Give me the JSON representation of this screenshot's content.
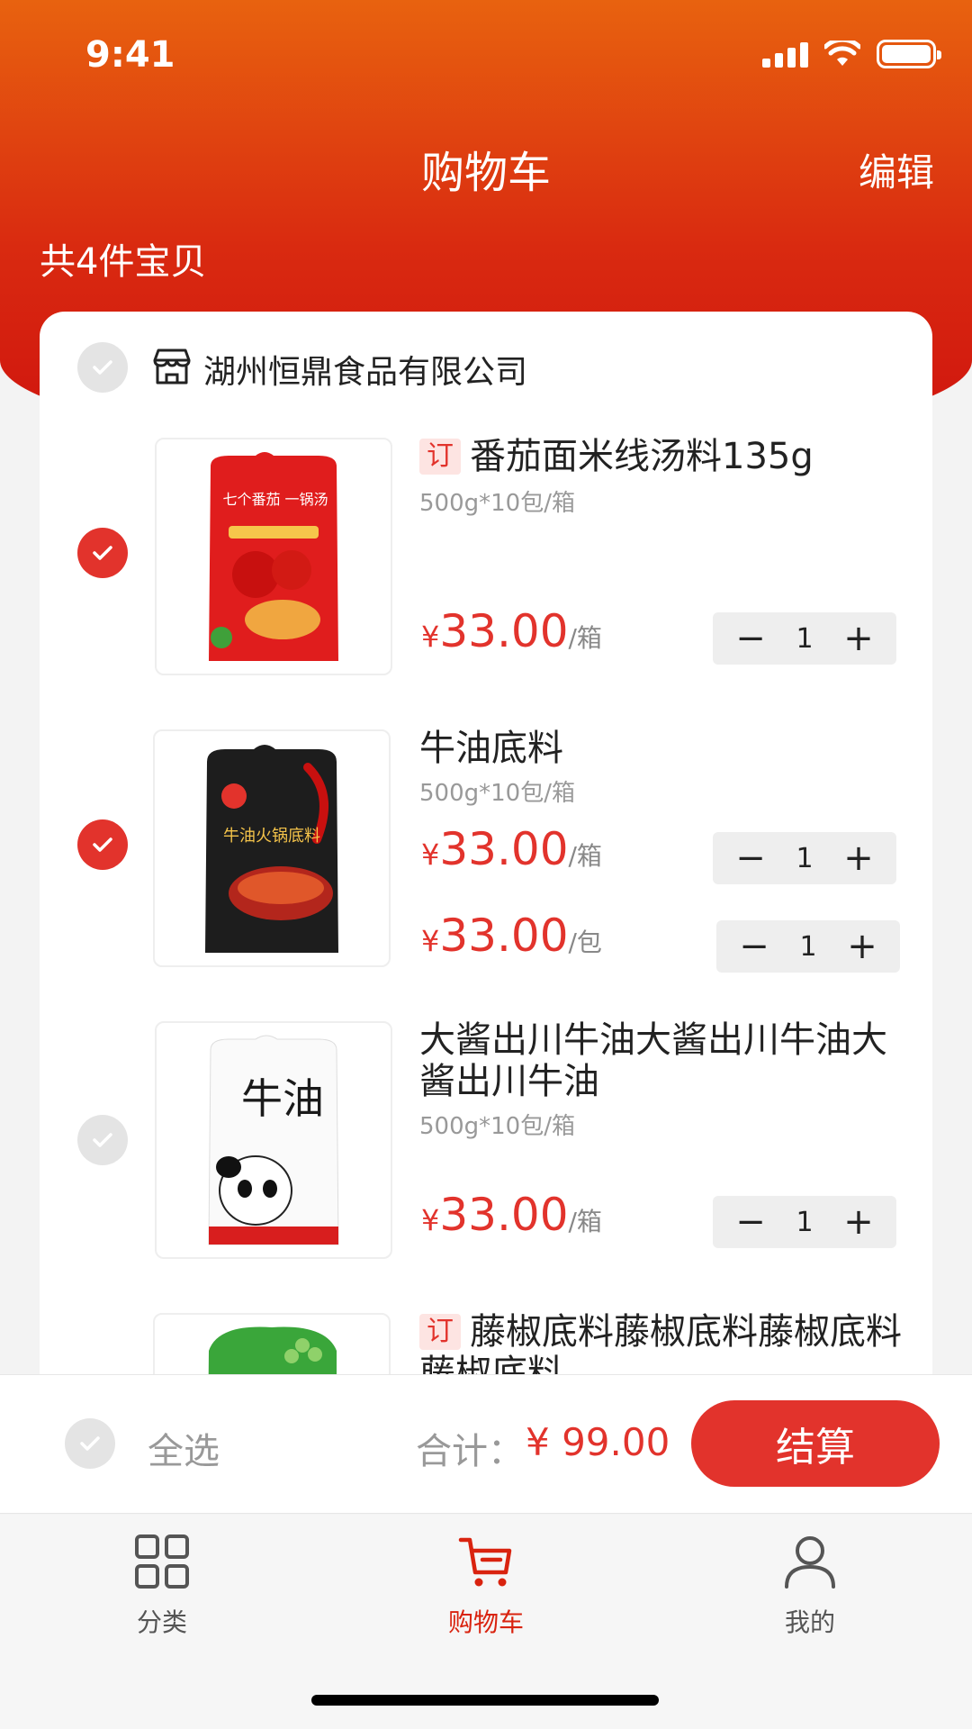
{
  "status_bar": {
    "time": "9:41"
  },
  "nav": {
    "title": "购物车",
    "edit_label": "编辑"
  },
  "cart": {
    "count_label": "共4件宝贝"
  },
  "shop": {
    "name": "湖州恒鼎食品有限公司",
    "selected": false
  },
  "items": [
    {
      "tag": "订",
      "title": "番茄面米线汤料135g",
      "spec": "500g*10包/箱",
      "selected": true,
      "image_label": "七个番茄 一锅汤",
      "prices": [
        {
          "currency": "¥",
          "value": "33.00",
          "unit": "/箱",
          "qty": "1"
        }
      ]
    },
    {
      "tag": "",
      "title": "牛油底料",
      "spec": "500g*10包/箱",
      "selected": true,
      "image_label": "牛油火锅底料",
      "prices": [
        {
          "currency": "¥",
          "value": "33.00",
          "unit": "/箱",
          "qty": "1"
        },
        {
          "currency": "¥",
          "value": "33.00",
          "unit": "/包",
          "qty": "1"
        }
      ]
    },
    {
      "tag": "",
      "title": "大酱出川牛油大酱出川牛油大酱出川牛油",
      "spec": "500g*10包/箱",
      "selected": false,
      "image_label": "牛油",
      "prices": [
        {
          "currency": "¥",
          "value": "33.00",
          "unit": "/箱",
          "qty": "1"
        }
      ]
    },
    {
      "tag": "订",
      "title": "藤椒底料藤椒底料藤椒底料藤椒底料",
      "selected": false
    }
  ],
  "stepper": {
    "minus": "−",
    "plus": "+"
  },
  "footer": {
    "select_all_label": "全选",
    "total_label": "合计：",
    "total_value": "¥ 99.00",
    "checkout_label": "结算"
  },
  "tabs": [
    {
      "label": "分类",
      "icon": "grid-icon",
      "active": false
    },
    {
      "label": "购物车",
      "icon": "cart-icon",
      "active": true
    },
    {
      "label": "我的",
      "icon": "user-icon",
      "active": false
    }
  ],
  "colors": {
    "accent": "#e2332c",
    "header_top": "#e8620f",
    "header_bottom": "#cf130e"
  }
}
